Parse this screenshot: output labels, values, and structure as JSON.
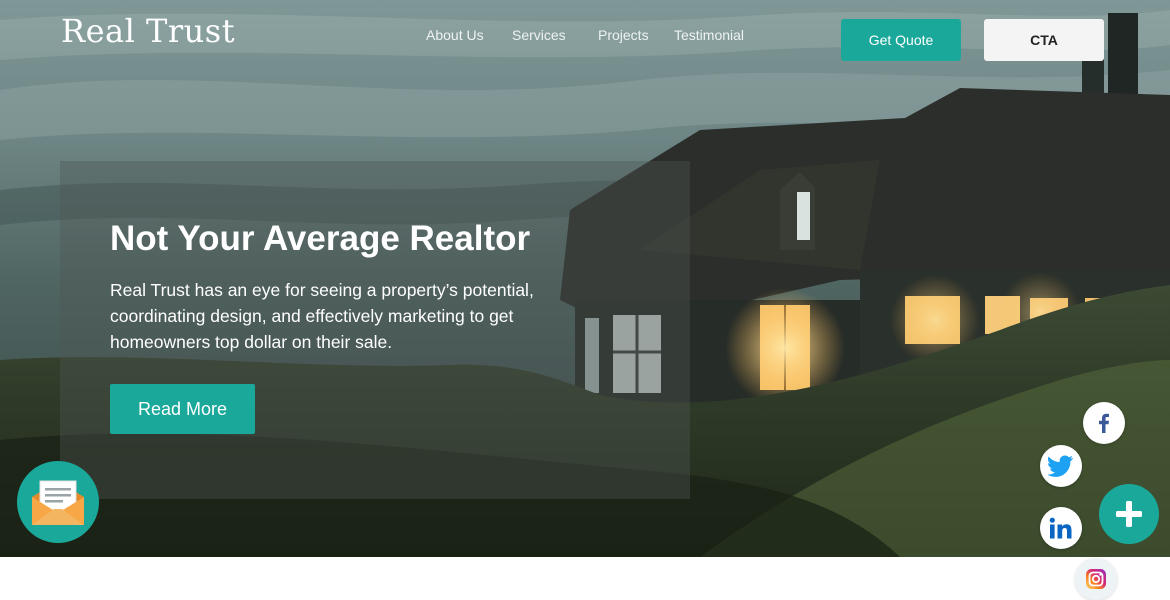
{
  "brand": {
    "logo_text": "Real Trust"
  },
  "nav": {
    "items": [
      {
        "label": "About Us"
      },
      {
        "label": "Services"
      },
      {
        "label": "Projects"
      },
      {
        "label": "Testimonial"
      }
    ]
  },
  "header_actions": {
    "quote_label": "Get Quote",
    "cta_label": "CTA"
  },
  "hero": {
    "title": "Not Your Average Realtor",
    "description": "Real Trust has an eye for seeing a property’s potential, coordinating design, and effectively  marketing to get homeowners top dollar on their sale.",
    "read_more_label": "Read More"
  },
  "floating": {
    "mail_icon": "mail-envelope-icon",
    "social_icons": [
      "facebook-icon",
      "twitter-icon",
      "linkedin-icon",
      "instagram-icon"
    ],
    "plus_icon": "plus-icon"
  },
  "colors": {
    "accent": "#1aa89a",
    "cta_background": "#f4f4f4",
    "facebook": "#3b5998",
    "twitter": "#1da1f2",
    "linkedin": "#0a66c2"
  }
}
